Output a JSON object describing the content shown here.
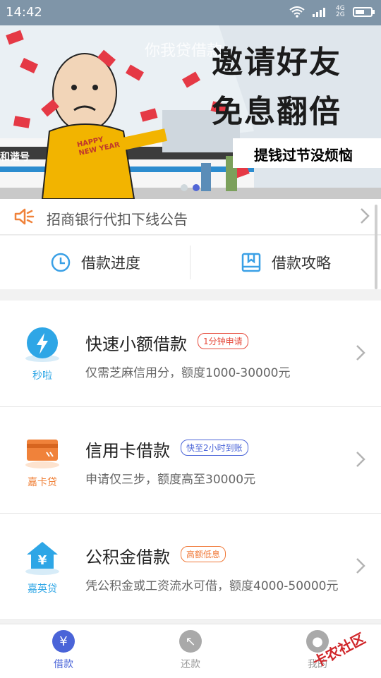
{
  "status": {
    "time": "14:42",
    "network": "4G 2G"
  },
  "banner": {
    "overlay_title": "你我贷借款",
    "headline1": "邀请好友",
    "headline2": "免息翻倍",
    "strip": "提钱过节没烦恼",
    "station_sign": "和谐号",
    "shirt_text": "HAPPY NEW YEAR"
  },
  "announcement": {
    "text": "招商银行代扣下线公告"
  },
  "quick": {
    "progress": "借款进度",
    "guide": "借款攻略"
  },
  "products": [
    {
      "icon_label": "秒啦",
      "title": "快速小额借款",
      "tag": "1分钟申请",
      "desc": "仅需芝麻信用分，额度1000-30000元",
      "tag_color": "#e64a3b"
    },
    {
      "icon_label": "嘉卡贷",
      "title": "信用卡借款",
      "tag": "快至2小时到账",
      "desc": "申请仅三步，额度高至30000元",
      "tag_color": "#4a64d8"
    },
    {
      "icon_label": "嘉英贷",
      "title": "公积金借款",
      "tag": "高额低息",
      "desc": "凭公积金或工资流水可借，额度4000-50000元",
      "tag_color": "#f07a3a"
    }
  ],
  "tabs": [
    {
      "label": "借款",
      "active": true
    },
    {
      "label": "还款",
      "active": false
    },
    {
      "label": "我的",
      "active": false
    }
  ],
  "watermark": "卡农社区",
  "colors": {
    "accent": "#4a64d8",
    "orange": "#f0823a",
    "blue_icon": "#2ea6e6"
  }
}
